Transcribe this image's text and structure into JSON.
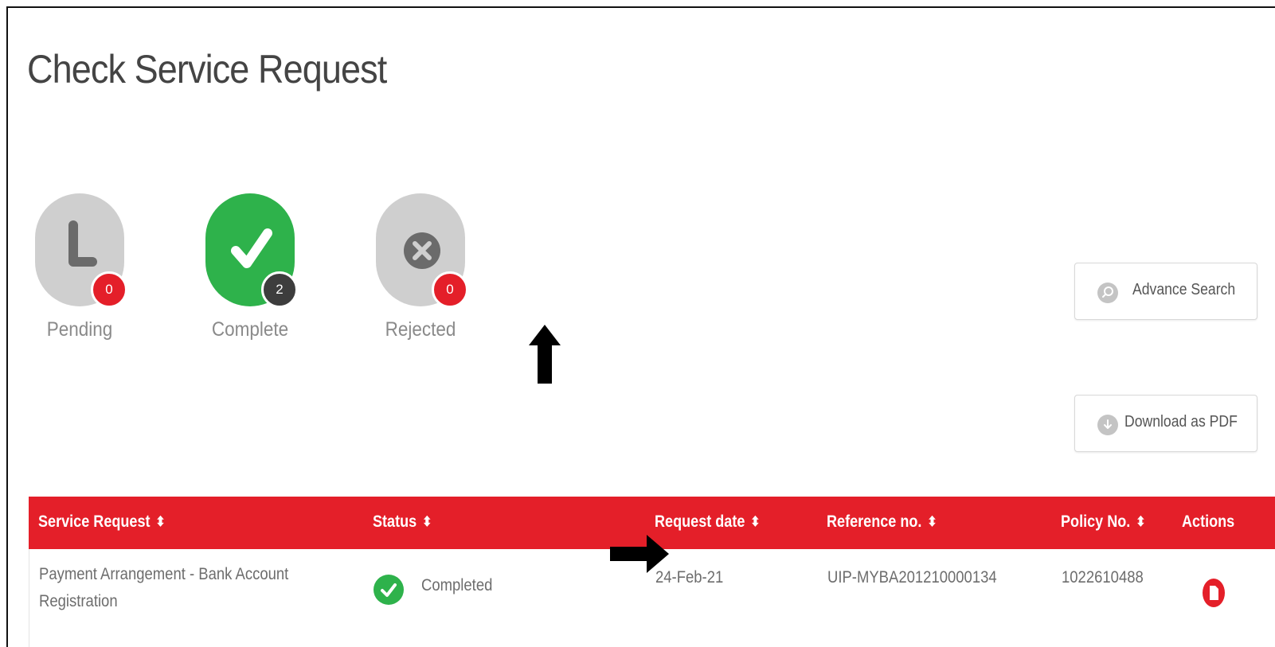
{
  "page": {
    "title": "Check Service Request"
  },
  "status_summary": [
    {
      "label": "Pending",
      "count": "0",
      "icon": "clock-icon",
      "color": "#cfcfcf",
      "badge_color": "#e41f29"
    },
    {
      "label": "Complete",
      "count": "2",
      "icon": "checkmark-icon",
      "color": "#2eb24b",
      "badge_color": "#3d3d3d"
    },
    {
      "label": "Rejected",
      "count": "0",
      "icon": "x-circle-icon",
      "color": "#cfcfcf",
      "badge_color": "#e41f29"
    }
  ],
  "actions": {
    "advance_search": {
      "label": "Advance Search",
      "icon": "search-icon"
    },
    "download_pdf": {
      "label": "Download as PDF",
      "icon": "download-icon"
    }
  },
  "table": {
    "header_color": "#e41f29",
    "columns": [
      {
        "label": "Service Request",
        "sortable": true
      },
      {
        "label": "Status",
        "sortable": true
      },
      {
        "label": "Request date",
        "sortable": true
      },
      {
        "label": "Reference no.",
        "sortable": true
      },
      {
        "label": "Policy No.",
        "sortable": true
      },
      {
        "label": "Actions",
        "sortable": false
      }
    ],
    "rows": [
      {
        "service_request_line1": "Payment Arrangement - Bank Account",
        "service_request_line2": "Registration",
        "status": "Completed",
        "request_date": "24-Feb-21",
        "reference_no": "UIP-MYBA201210000134",
        "policy_no": "1022610488",
        "action_icon": "pdf-document-icon"
      }
    ]
  },
  "annotations": {
    "up_arrow": "up-arrow-annotation",
    "right_arrow": "right-arrow-annotation"
  }
}
